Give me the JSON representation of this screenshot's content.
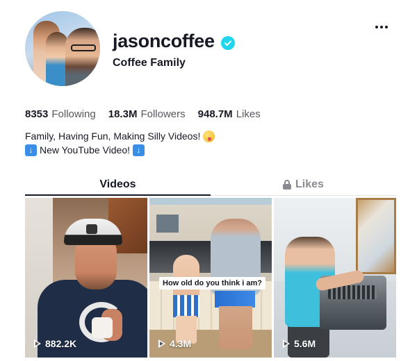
{
  "profile": {
    "username": "jasoncoffee",
    "nickname": "Coffee Family",
    "verified": true,
    "accent_color": "#20d5ec"
  },
  "stats": {
    "following_count": "8353",
    "following_label": "Following",
    "followers_count": "18.3M",
    "followers_label": "Followers",
    "likes_count": "948.7M",
    "likes_label": "Likes"
  },
  "bio": {
    "line1": "Family, Having Fun, Making Silly Videos!",
    "line1_emoji": "zany-face-emoji",
    "line2": "New YouTube Video!",
    "line2_emoji": "down-arrow-emoji"
  },
  "tabs": [
    {
      "label": "Videos",
      "active": true
    },
    {
      "label": "Likes",
      "active": false,
      "icon": "lock-icon"
    }
  ],
  "videos": [
    {
      "views": "882.2K"
    },
    {
      "views": "4.3M",
      "caption": "How old do you think i am?"
    },
    {
      "views": "5.6M"
    }
  ]
}
